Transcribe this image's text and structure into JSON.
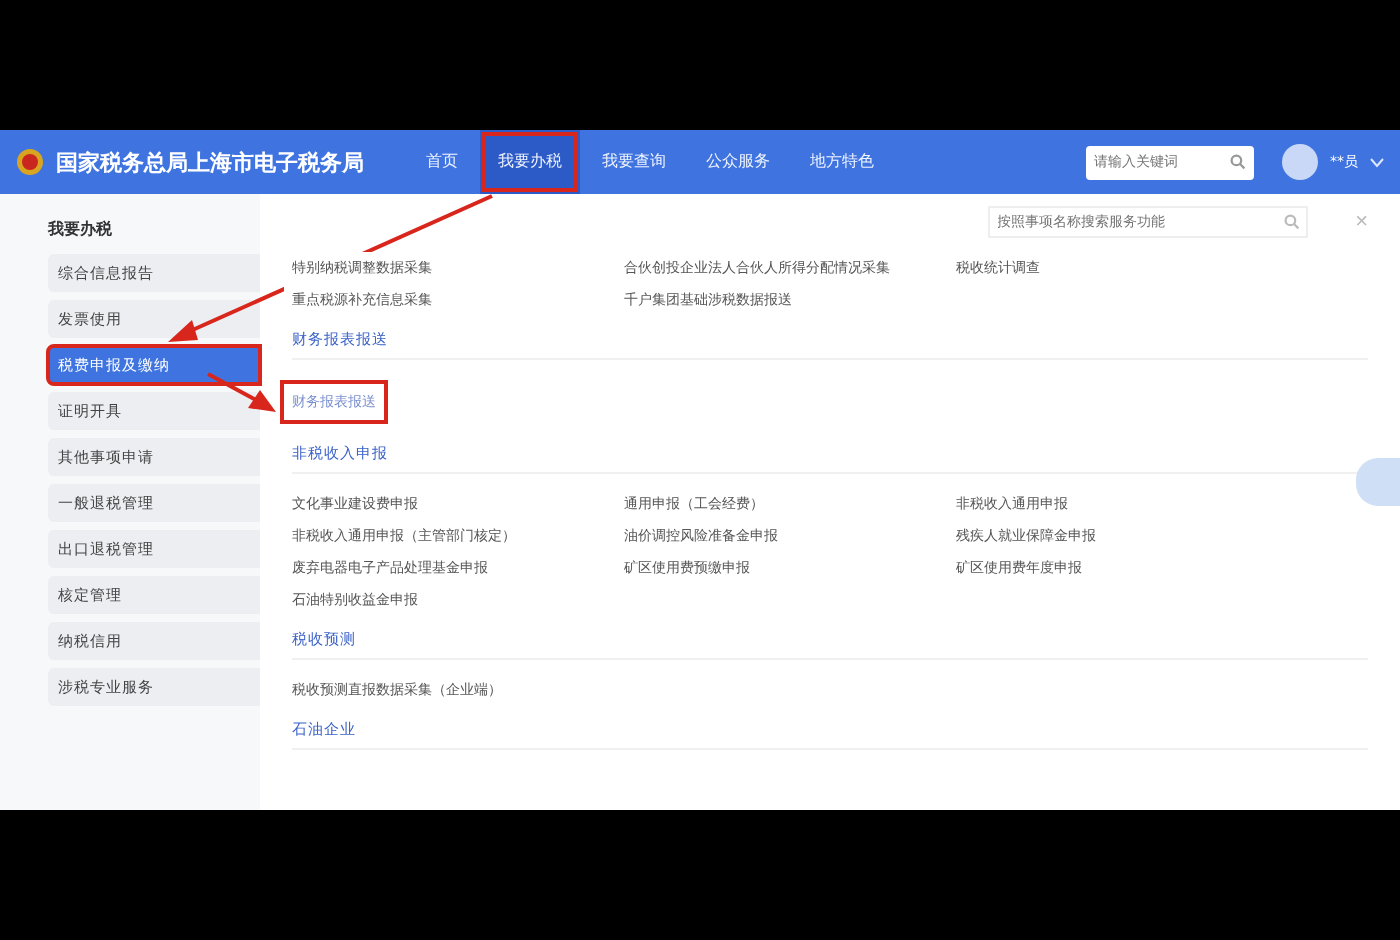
{
  "header": {
    "title": "国家税务总局上海市电子税务局",
    "nav": [
      {
        "label": "首页",
        "selected": false,
        "annotated": false
      },
      {
        "label": "我要办税",
        "selected": true,
        "annotated": true
      },
      {
        "label": "我要查询",
        "selected": false,
        "annotated": false
      },
      {
        "label": "公众服务",
        "selected": false,
        "annotated": false
      },
      {
        "label": "地方特色",
        "selected": false,
        "annotated": false
      }
    ],
    "search": {
      "placeholder": "请输入关键词"
    },
    "user": "**员"
  },
  "sidebar": {
    "title": "我要办税",
    "items": [
      {
        "label": "综合信息报告",
        "selected": false,
        "annotated": false
      },
      {
        "label": "发票使用",
        "selected": false,
        "annotated": false
      },
      {
        "label": "税费申报及缴纳",
        "selected": true,
        "annotated": true
      },
      {
        "label": "证明开具",
        "selected": false,
        "annotated": false
      },
      {
        "label": "其他事项申请",
        "selected": false,
        "annotated": false
      },
      {
        "label": "一般退税管理",
        "selected": false,
        "annotated": false
      },
      {
        "label": "出口退税管理",
        "selected": false,
        "annotated": false
      },
      {
        "label": "核定管理",
        "selected": false,
        "annotated": false
      },
      {
        "label": "纳税信用",
        "selected": false,
        "annotated": false
      },
      {
        "label": "涉税专业服务",
        "selected": false,
        "annotated": false
      }
    ]
  },
  "content": {
    "search": {
      "placeholder": "按照事项名称搜索服务功能"
    },
    "close": "×",
    "top_rows": [
      [
        "特别纳税调整数据采集",
        "合伙创投企业法人合伙人所得分配情况采集",
        "税收统计调查"
      ],
      [
        "重点税源补充信息采集",
        "千户集团基础涉税数据报送"
      ]
    ],
    "sections": [
      {
        "title": "财务报表报送",
        "items": [
          {
            "label": "财务报表报送",
            "annotated": true
          }
        ]
      },
      {
        "title": "非税收入申报",
        "items": [
          {
            "label": "文化事业建设费申报",
            "annotated": false
          },
          {
            "label": "通用申报（工会经费）",
            "annotated": false
          },
          {
            "label": "非税收入通用申报",
            "annotated": false
          },
          {
            "label": "非税收入通用申报（主管部门核定）",
            "annotated": false
          },
          {
            "label": "油价调控风险准备金申报",
            "annotated": false
          },
          {
            "label": "残疾人就业保障金申报",
            "annotated": false
          },
          {
            "label": "废弃电器电子产品处理基金申报",
            "annotated": false
          },
          {
            "label": "矿区使用费预缴申报",
            "annotated": false
          },
          {
            "label": "矿区使用费年度申报",
            "annotated": false
          },
          {
            "label": "石油特别收益金申报",
            "annotated": false
          }
        ]
      },
      {
        "title": "税收预测",
        "items": [
          {
            "label": "税收预测直报数据采集（企业端）",
            "annotated": false
          }
        ]
      },
      {
        "title": "石油企业"
      }
    ]
  }
}
